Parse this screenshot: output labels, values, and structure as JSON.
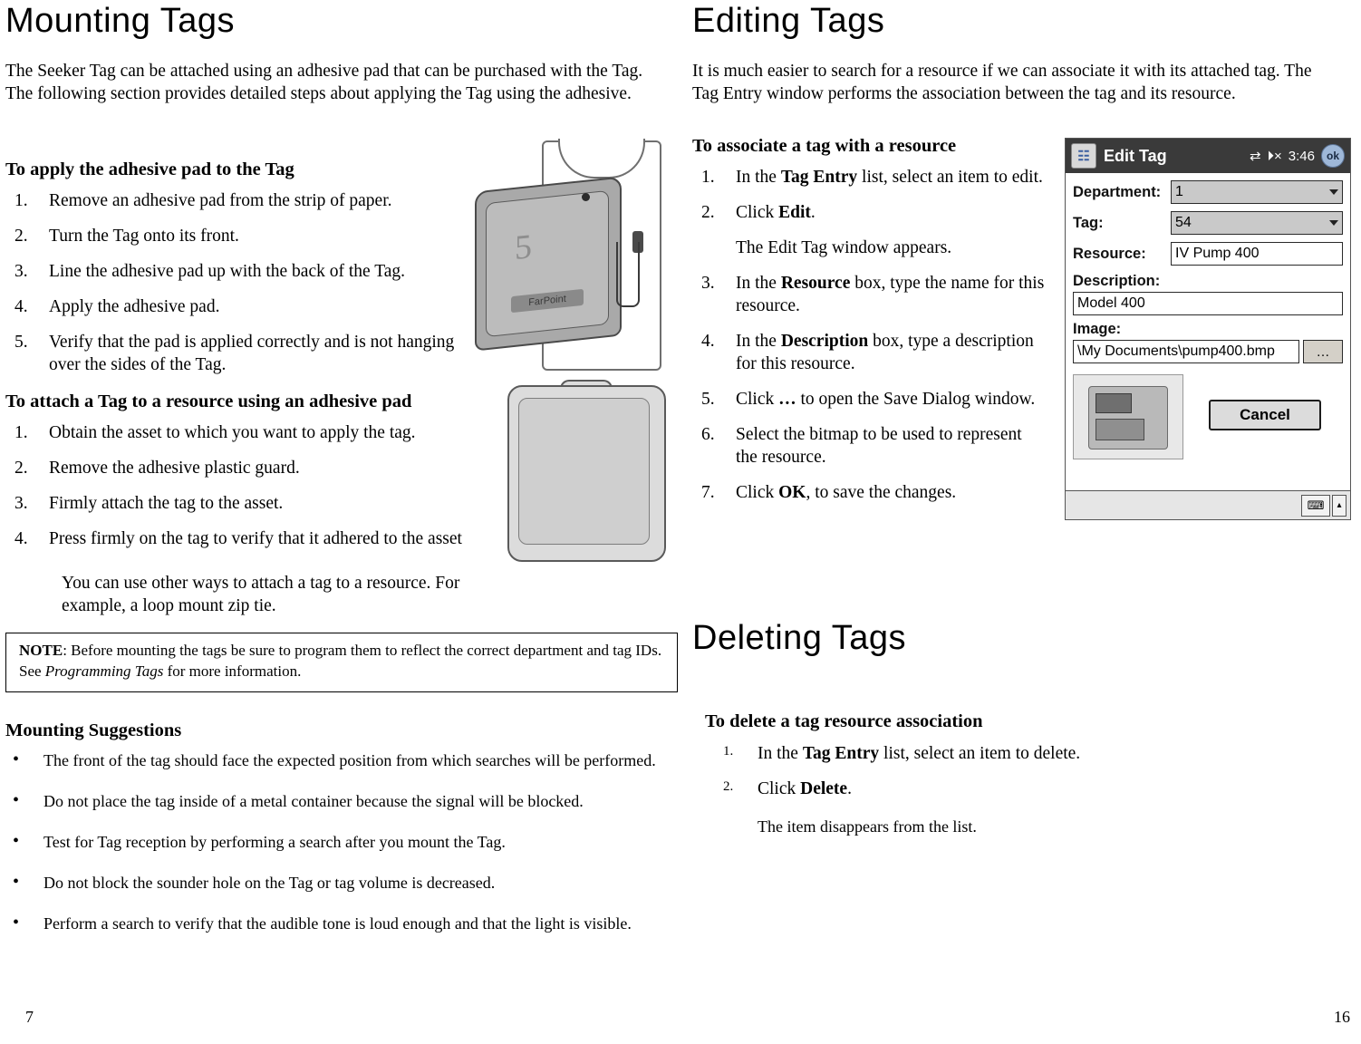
{
  "left": {
    "title": "Mounting Tags",
    "intro": "The Seeker Tag can be attached using an adhesive pad that can be purchased with the Tag. The following section provides detailed steps about applying the Tag using the adhesive.",
    "section1": {
      "heading": "To apply the adhesive pad to the Tag",
      "steps": [
        "Remove an adhesive pad from the strip of paper.",
        "Turn the Tag onto its front.",
        "Line the adhesive pad up with the back of the Tag.",
        "Apply the adhesive pad.",
        "Verify that the pad is applied correctly and is not hanging over the sides of the Tag."
      ]
    },
    "section2": {
      "heading": "To attach a Tag to a resource using an adhesive pad",
      "steps": [
        "Obtain the asset to which you want to apply the tag.",
        "Remove the adhesive plastic guard.",
        "Firmly attach the tag to the asset.",
        "Press firmly on the tag to verify that it adhered to the asset"
      ],
      "note": "You can use other ways to attach a tag to a resource. For example, a loop mount zip tie."
    },
    "note_box": {
      "label": "NOTE",
      "text_part1": ": Before mounting the tags be sure to program them to reflect the correct department and tag IDs.  See ",
      "italic": "Programming Tags",
      "text_part2": " for more information."
    },
    "suggestions": {
      "heading": "Mounting Suggestions",
      "bullet_glyph": "•",
      "items": [
        "The front of the tag should face the expected position from which searches will be performed.",
        "Do not place the tag inside of a metal container because the signal will be blocked.",
        "Test for  Tag reception by performing a search after you mount the Tag.",
        "Do not block the sounder hole on the Tag or tag volume is decreased.",
        "Perform a search  to verify that the audible tone is loud enough and that the light is visible."
      ]
    },
    "tag_illustration": {
      "logo_text": "FarPoint",
      "face_number": "5"
    },
    "page_number": "7"
  },
  "right": {
    "title": "Editing Tags",
    "intro": "It is much easier to search for a resource if we can associate it with its attached tag. The Tag Entry window performs the association between the tag and its resource.",
    "section1": {
      "heading": "To associate a tag with a resource",
      "steps": [
        {
          "pre": "In the ",
          "bold": "Tag Entry",
          "post": " list, select an item to edit."
        },
        {
          "pre": "Click ",
          "bold": "Edit",
          "post": "."
        },
        {
          "pre": "",
          "bold": "",
          "post": "The Edit Tag window appears.",
          "plain": true
        },
        {
          "pre": "In the ",
          "bold": "Resource",
          "post": " box, type the name for this resource."
        },
        {
          "pre": "In the ",
          "bold": "Description",
          "post": " box, type a description for this resource."
        },
        {
          "pre": "Click ",
          "bold": "…",
          "post": " to open the Save Dialog window."
        },
        {
          "pre": "Select the bitmap to be used to represent the resource.",
          "bold": "",
          "post": ""
        },
        {
          "pre": "Click ",
          "bold": "OK",
          "post": ", to save the changes."
        }
      ]
    },
    "title2": "Deleting Tags",
    "section2": {
      "heading": "To delete a tag resource association",
      "steps": [
        {
          "num": "1.",
          "pre": "In the ",
          "bold": "Tag Entry",
          "post": " list, select an item to delete."
        },
        {
          "num": "2.",
          "pre": "Click ",
          "bold": "Delete",
          "post": "."
        }
      ],
      "result": "The item disappears from the list."
    },
    "page_number": "16"
  },
  "pda": {
    "start_icon": "windows-start-icon",
    "title": "Edit Tag",
    "connectivity_icon": "⇄",
    "volume_icon": "⏵×",
    "time": "3:46",
    "ok_label": "ok",
    "fields": {
      "department_label": "Department:",
      "department_value": "1",
      "tag_label": "Tag:",
      "tag_value": "54",
      "resource_label": "Resource:",
      "resource_value": "IV Pump 400",
      "description_label": "Description:",
      "description_value": "Model 400",
      "image_label": "Image:",
      "image_value": "\\My Documents\\pump400.bmp",
      "browse_label": "…"
    },
    "cancel_label": "Cancel",
    "keyboard_icon": "⌨",
    "updown_icon": "▴"
  }
}
